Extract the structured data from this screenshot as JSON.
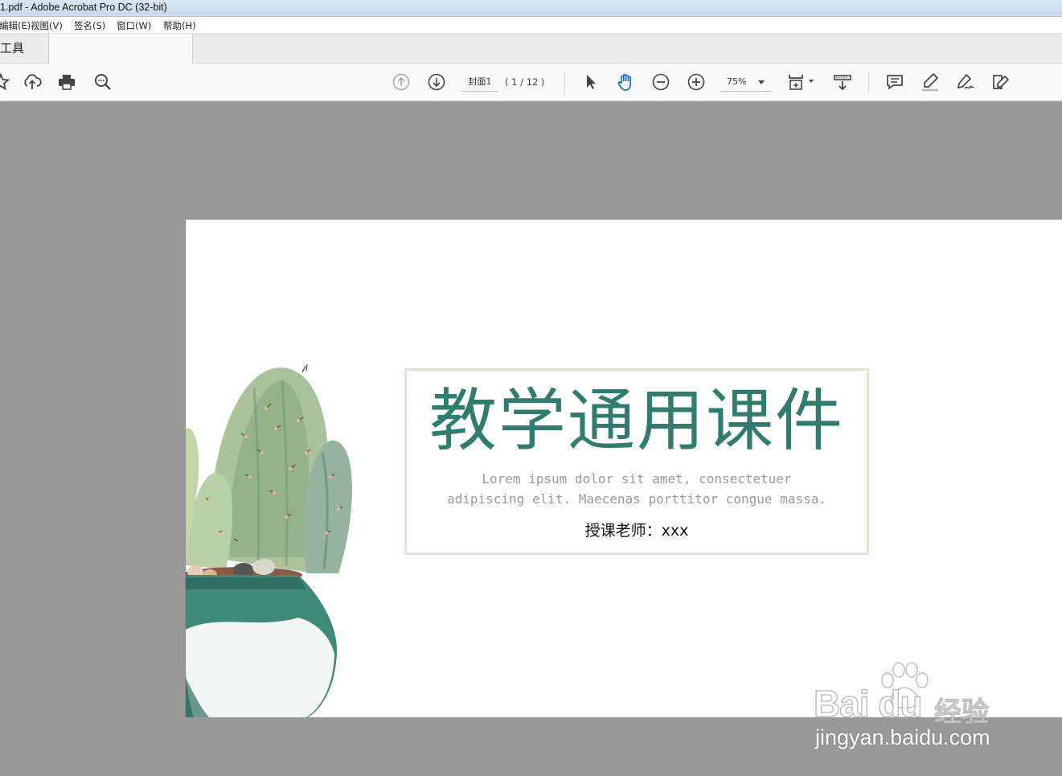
{
  "window": {
    "title": "1.pdf - Adobe Acrobat Pro DC (32-bit)"
  },
  "menu": [
    {
      "label": "编辑(E)"
    },
    {
      "label": "视图(V)"
    },
    {
      "label": "签名(S)"
    },
    {
      "label": "窗口(W)"
    },
    {
      "label": "帮助(H)"
    }
  ],
  "tabs": {
    "tools_label": "工具"
  },
  "toolbar": {
    "page_label": "封面1",
    "page_count": "( 1 / 12 )",
    "zoom": "75%",
    "icons": [
      "star-icon",
      "upload-cloud-icon",
      "print-icon",
      "zoom-search-icon",
      "prev-page-icon",
      "next-page-icon",
      "select-arrow-icon",
      "hand-icon",
      "zoom-out-icon",
      "zoom-in-icon",
      "fit-page-icon",
      "scroll-mode-icon",
      "comment-icon",
      "highlight-pen-icon",
      "sign-icon",
      "fill-sign-icon"
    ]
  },
  "document": {
    "title": "教学通用课件",
    "lorem_line1": "Lorem ipsum dolor sit amet, consectetuer",
    "lorem_line2": "adipiscing elit. Maecenas porttitor congue massa.",
    "teacher": "授课老师：xxx",
    "colors": {
      "title": "#2e7d6e",
      "box_border": "#dfe5d8"
    }
  },
  "watermark": {
    "logo": "Bai du",
    "brand": "经验",
    "url": "jingyan.baidu.com"
  }
}
